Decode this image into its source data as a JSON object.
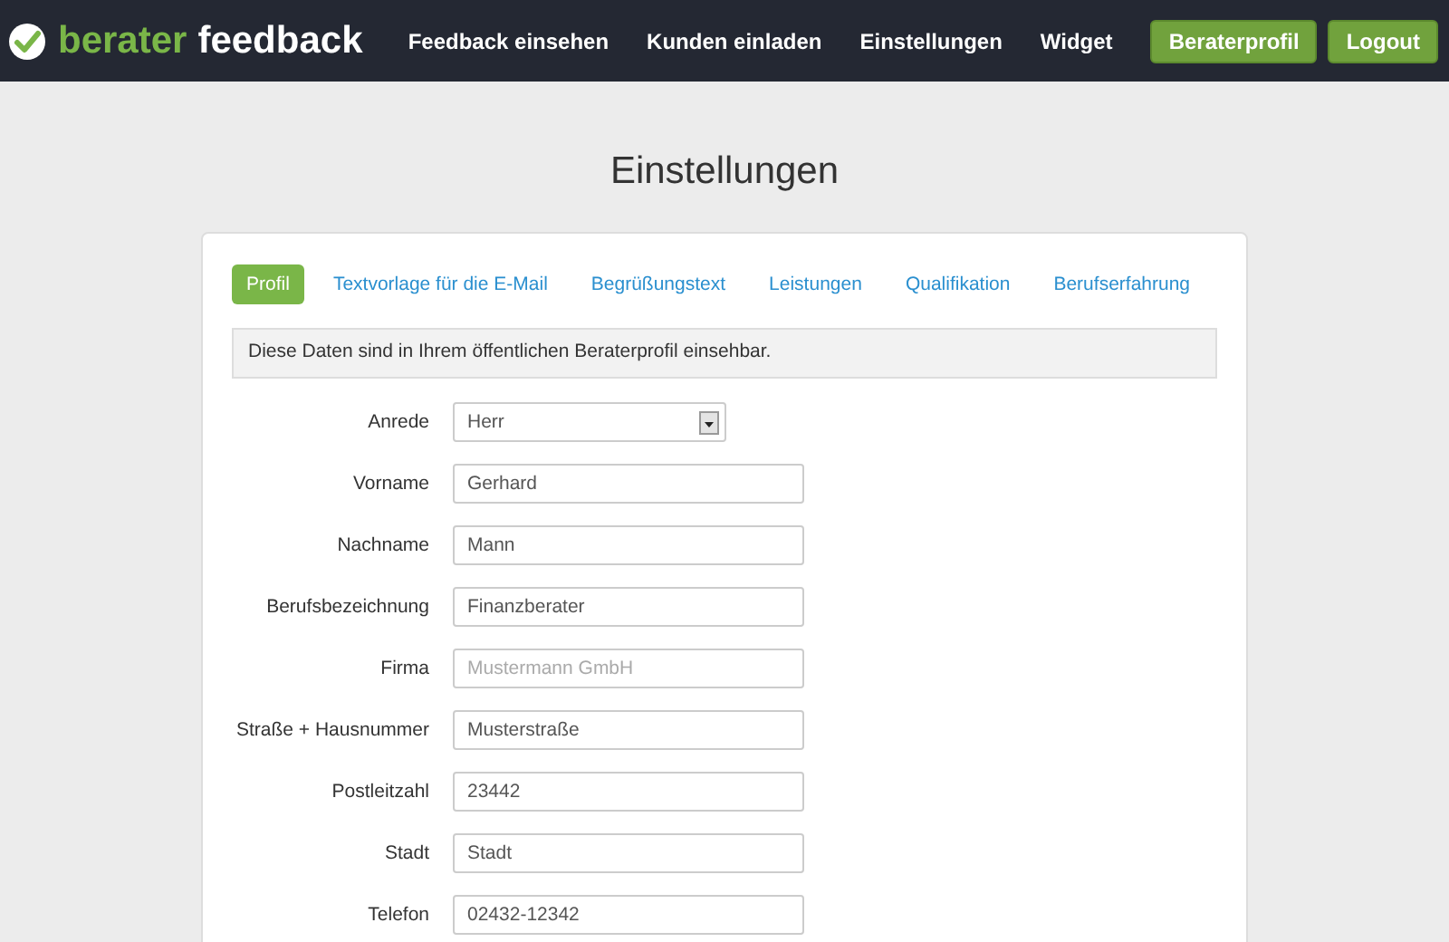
{
  "logo": {
    "part_1": "berater",
    "part_2": "feedback"
  },
  "nav": [
    {
      "label": "Feedback einsehen",
      "kind": "link"
    },
    {
      "label": "Kunden einladen",
      "kind": "link"
    },
    {
      "label": "Einstellungen",
      "kind": "link"
    },
    {
      "label": "Widget",
      "kind": "link"
    },
    {
      "label": "Beraterprofil",
      "kind": "button"
    },
    {
      "label": "Logout",
      "kind": "button"
    }
  ],
  "page_title": "Einstellungen",
  "tabs": [
    {
      "label": "Profil",
      "selected": true
    },
    {
      "label": "Textvorlage für die E-Mail",
      "selected": false
    },
    {
      "label": "Begrüßungstext",
      "selected": false
    },
    {
      "label": "Leistungen",
      "selected": false
    },
    {
      "label": "Qualifikation",
      "selected": false
    },
    {
      "label": "Berufserfahrung",
      "selected": false
    }
  ],
  "info": "Diese Daten sind in Ihrem öffentlichen Beraterprofil einsehbar.",
  "fields": [
    {
      "label": "Anrede",
      "kind": "select",
      "value": "Herr"
    },
    {
      "label": "Vorname",
      "kind": "text",
      "value": "Gerhard"
    },
    {
      "label": "Nachname",
      "kind": "text",
      "value": "Mann"
    },
    {
      "label": "Berufsbezeichnung",
      "kind": "text",
      "value": "Finanzberater"
    },
    {
      "label": "Firma",
      "kind": "text",
      "placeholder": "Mustermann GmbH"
    },
    {
      "label": "Straße + Hausnummer",
      "kind": "text",
      "value": "Musterstraße"
    },
    {
      "label": "Postleitzahl",
      "kind": "text",
      "value": "23442"
    },
    {
      "label": "Stadt",
      "kind": "text",
      "value": "Stadt"
    },
    {
      "label": "Telefon",
      "kind": "text",
      "value": "02432-12342"
    }
  ]
}
